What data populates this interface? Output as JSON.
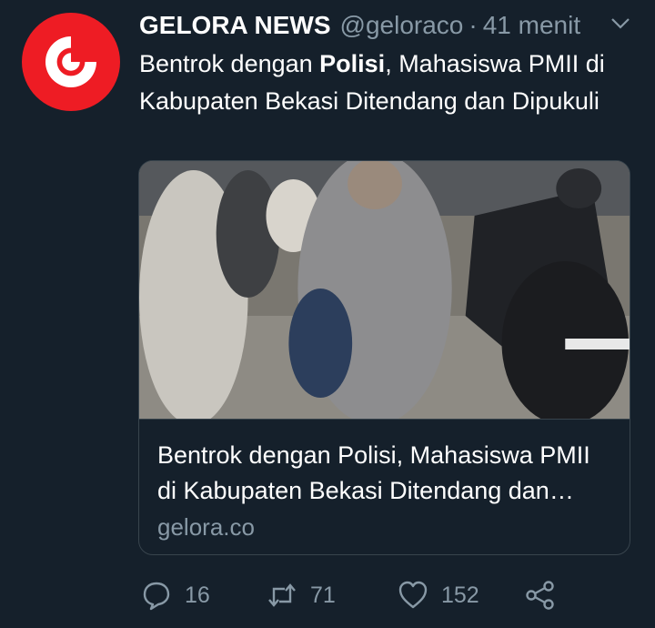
{
  "tweet": {
    "author_name": "GELORA NEWS",
    "handle": "@geloraco",
    "separator": "·",
    "time": "41 menit",
    "text_before": "Bentrok dengan ",
    "text_bold": "Polisi",
    "text_after": ", Mahasiswa PMII di Kabupaten Bekasi Ditendang dan Dipukuli"
  },
  "card": {
    "title": "Bentrok dengan Polisi, Mahasiswa PMII di Kabupaten Bekasi Ditendang dan Dipukuli",
    "domain": "gelora.co"
  },
  "actions": {
    "replies": "16",
    "retweets": "71",
    "likes": "152"
  },
  "colors": {
    "background": "#15202b",
    "secondary_text": "#8899a6",
    "border": "#38444d",
    "avatar_red": "#ee1c24"
  },
  "icons": {
    "avatar": "gelora-logo-icon",
    "menu": "chevron-down-icon",
    "reply": "reply-icon",
    "retweet": "retweet-icon",
    "like": "heart-icon",
    "share": "share-icon"
  }
}
